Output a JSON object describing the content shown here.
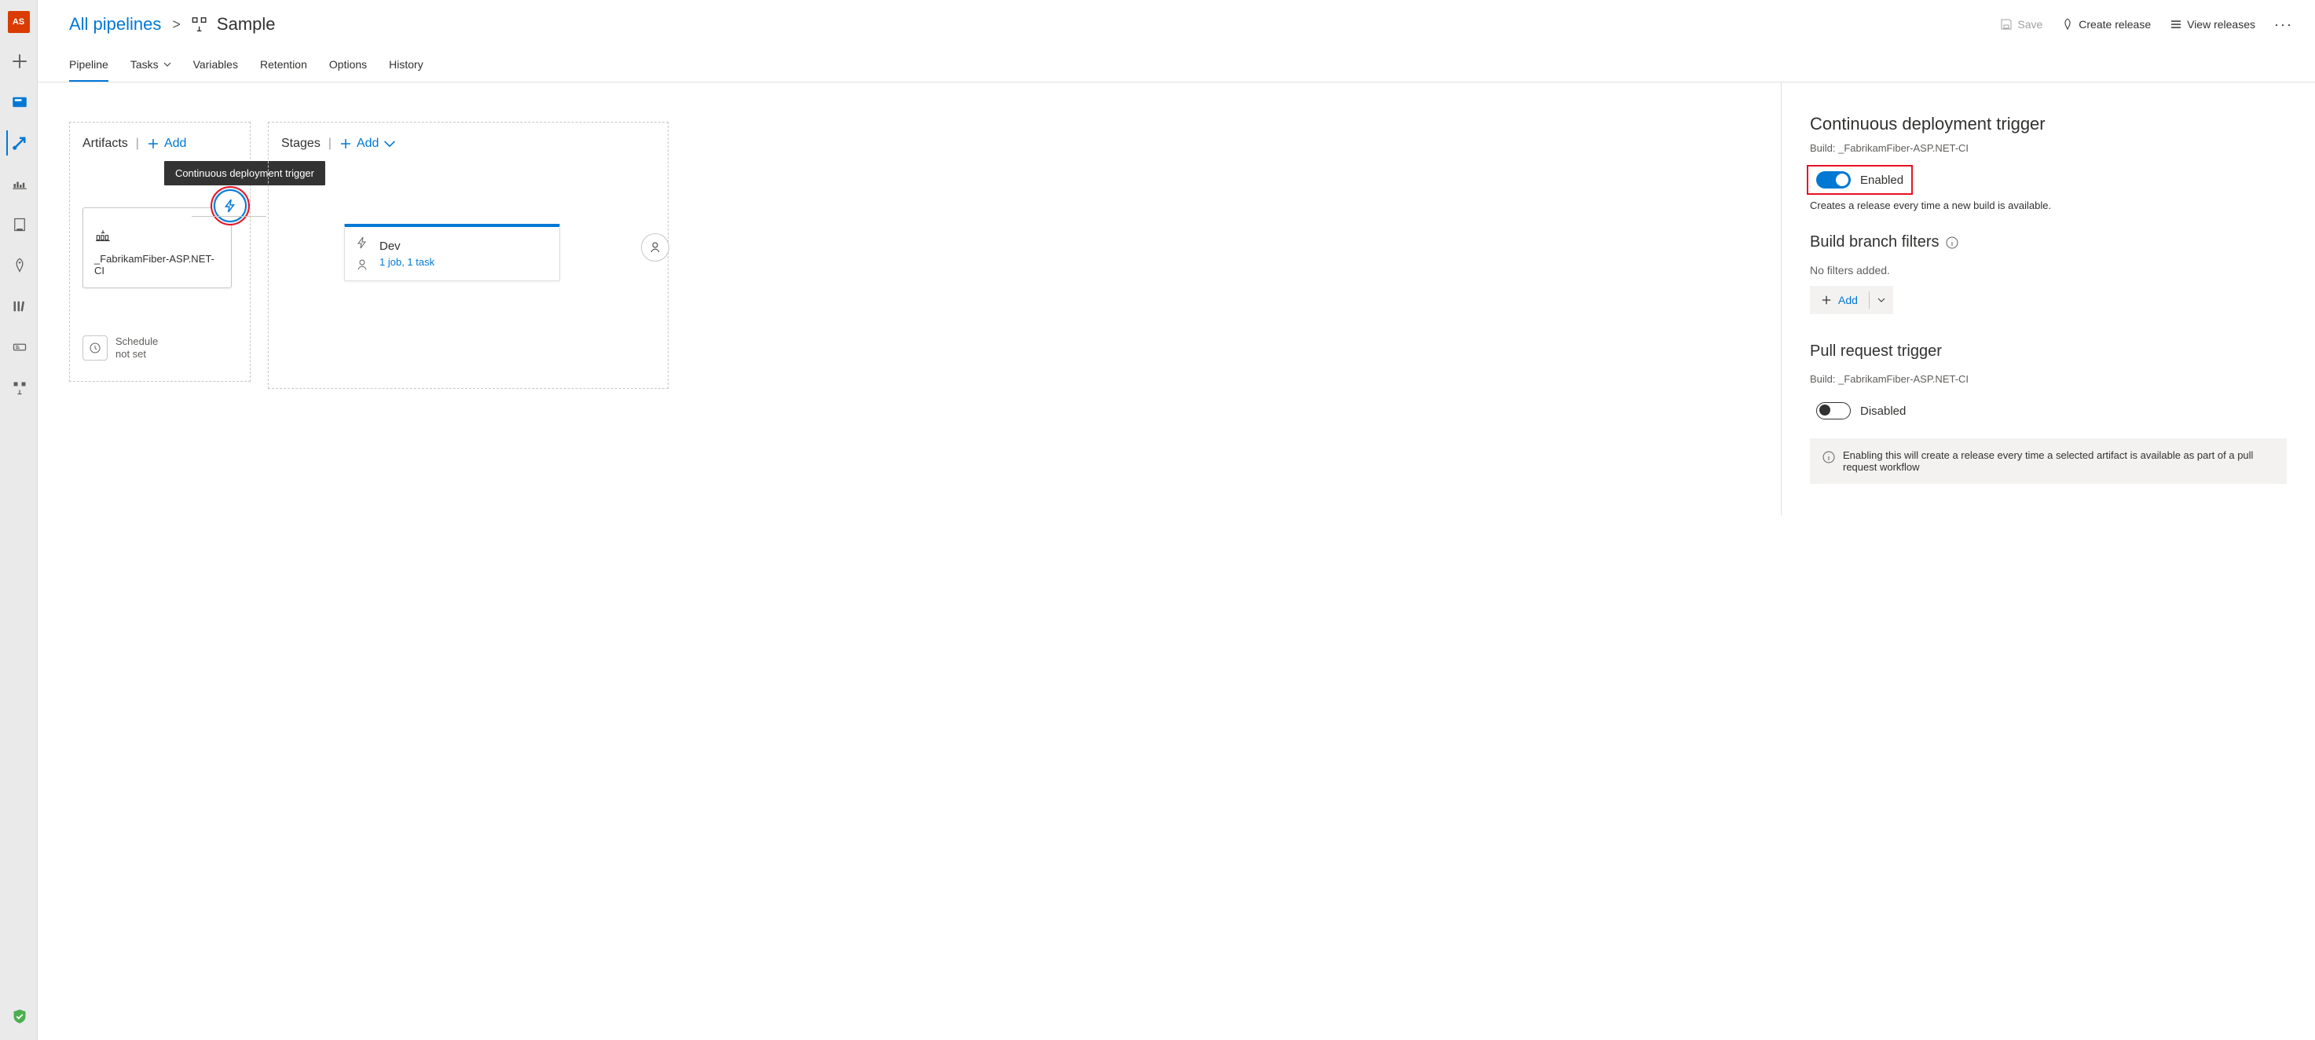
{
  "avatar_initials": "AS",
  "breadcrumb": {
    "root": "All pipelines",
    "sep": ">",
    "current": "Sample"
  },
  "actions": {
    "save": "Save",
    "create_release": "Create release",
    "view_releases": "View releases"
  },
  "tabs": {
    "pipeline": "Pipeline",
    "tasks": "Tasks",
    "variables": "Variables",
    "retention": "Retention",
    "options": "Options",
    "history": "History"
  },
  "artifacts": {
    "header": "Artifacts",
    "add": "Add",
    "tooltip": "Continuous deployment trigger",
    "card_name": "_FabrikamFiber-ASP.NET-CI",
    "schedule_line1": "Schedule",
    "schedule_line2": "not set"
  },
  "stages": {
    "header": "Stages",
    "add": "Add",
    "card": {
      "name": "Dev",
      "sub": "1 job, 1 task"
    }
  },
  "panel": {
    "cd_trigger": {
      "title": "Continuous deployment trigger",
      "build_line": "Build: _FabrikamFiber-ASP.NET-CI",
      "toggle": "Enabled",
      "note": "Creates a release every time a new build is available."
    },
    "branch_filters": {
      "title": "Build branch filters",
      "empty": "No filters added.",
      "add": "Add"
    },
    "pr_trigger": {
      "title": "Pull request trigger",
      "build_line": "Build: _FabrikamFiber-ASP.NET-CI",
      "toggle": "Disabled",
      "info": "Enabling this will create a release every time a selected artifact is available as part of a pull request workflow"
    }
  }
}
